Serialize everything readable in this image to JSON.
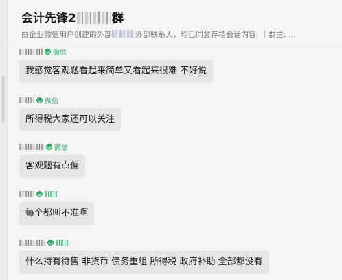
{
  "header": {
    "title_prefix": "会计先锋2",
    "title_suffix": "群",
    "subtitle_part1": "由企业微信用户创建的外部",
    "subtitle_part2": "外部联系人，均已同意存档会话内容",
    "subtitle_part3": "｜群主: ..."
  },
  "messages": [
    {
      "org": "微信",
      "text": "我感觉客观题看起来简单又看起来很难 不好说"
    },
    {
      "org": "微信",
      "text": "所得税大家还可以关注"
    },
    {
      "org": "微信",
      "text": "客观题有点偏"
    },
    {
      "org": "",
      "text": "每个都叫不准啊"
    },
    {
      "org": "",
      "text": "什么持有待售 非货币 债务重组 所得税 政府补助 全部都没有"
    }
  ]
}
